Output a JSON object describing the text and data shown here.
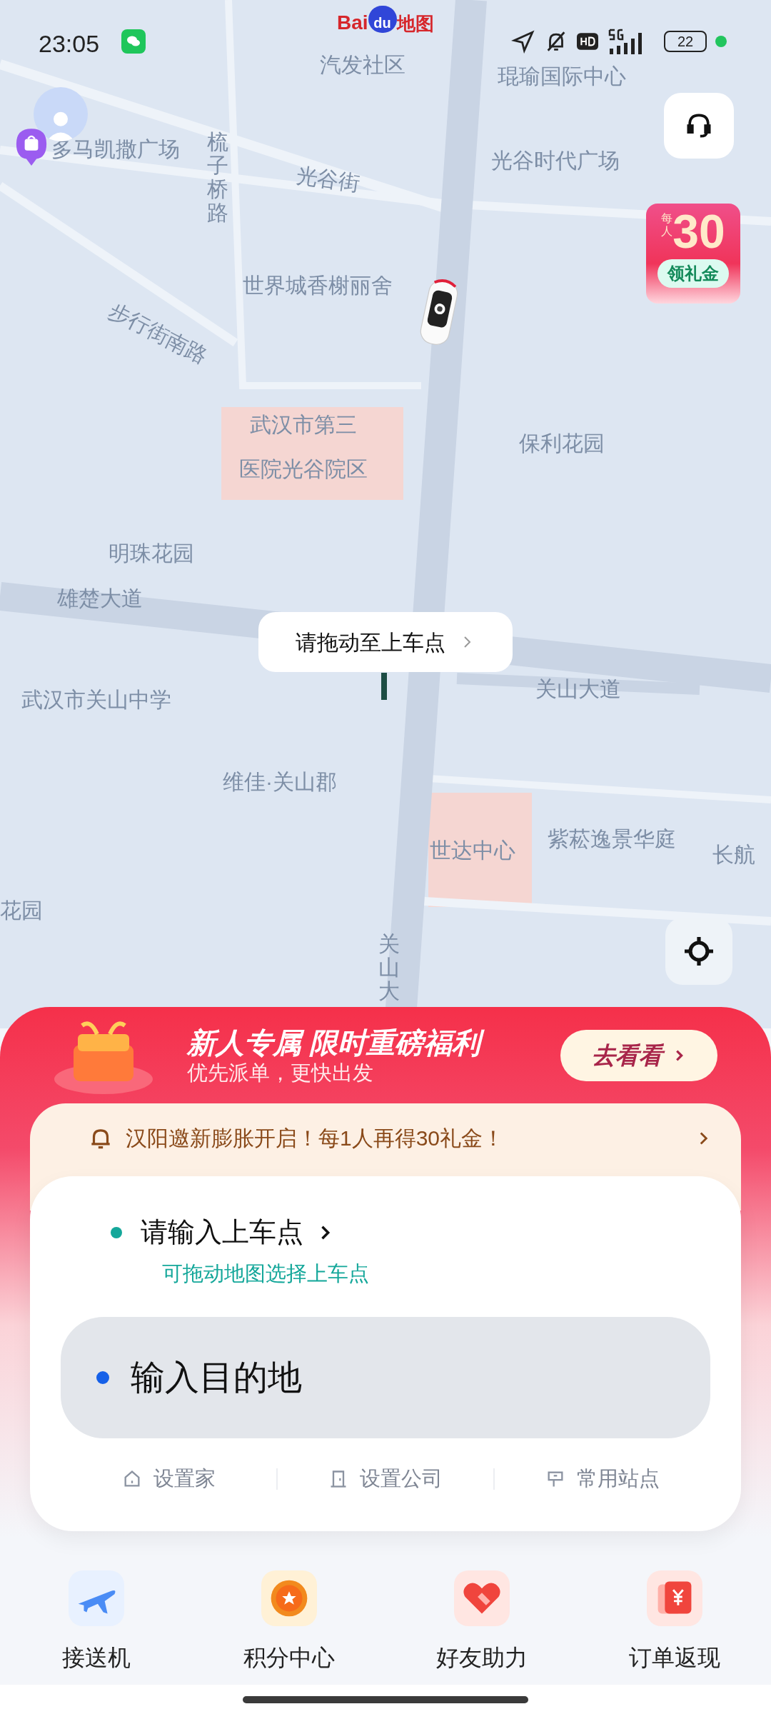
{
  "status_bar": {
    "time": "23:05",
    "battery": "22"
  },
  "map_logo": {
    "left": "Bai",
    "paw": "du",
    "right": "地图"
  },
  "map_labels": [
    {
      "text": "汽发社区",
      "kind": "flat"
    },
    {
      "text": "琨瑜国际中心",
      "kind": "flat"
    },
    {
      "text": "多马凯撒广场",
      "kind": "flat"
    },
    {
      "text": "梳子桥路",
      "kind": "vertical"
    },
    {
      "text": "光谷街",
      "kind": "tilted"
    },
    {
      "text": "光谷时代广场",
      "kind": "flat"
    },
    {
      "text": "世界城香榭丽舍",
      "kind": "flat"
    },
    {
      "text": "步行街南路",
      "kind": "tilted"
    },
    {
      "text": "武汉市第三",
      "kind": "flat"
    },
    {
      "text": "医院光谷院区",
      "kind": "flat"
    },
    {
      "text": "保利花园",
      "kind": "flat"
    },
    {
      "text": "明珠花园",
      "kind": "flat"
    },
    {
      "text": "雄楚大道",
      "kind": "flat"
    },
    {
      "text": "武汉市关山中学",
      "kind": "flat"
    },
    {
      "text": "关山大道",
      "kind": "flat"
    },
    {
      "text": "维佳·关山郡",
      "kind": "flat"
    },
    {
      "text": "世达中心",
      "kind": "flat"
    },
    {
      "text": "紫菘逸景华庭",
      "kind": "flat"
    },
    {
      "text": "长航",
      "kind": "flat"
    },
    {
      "text": "花园",
      "kind": "flat"
    },
    {
      "text": "关山大",
      "kind": "vertical"
    }
  ],
  "gift_badge": {
    "top": "每人",
    "amount": "30",
    "label": "领礼金"
  },
  "pickup_tip": {
    "text": "请拖动至上车点"
  },
  "promo_banner": {
    "title": "新人专属 限时重磅福利",
    "subtitle": "优先派单，更快出发",
    "button": "去看看"
  },
  "notice": {
    "text": "汉阳邀新膨胀开启！每1人再得30礼金！"
  },
  "pickup": {
    "label": "请输入上车点",
    "hint": "可拖动地图选择上车点"
  },
  "destination": {
    "placeholder": "输入目的地"
  },
  "quick_links": [
    "设置家",
    "设置公司",
    "常用站点"
  ],
  "bottom_nav": [
    "接送机",
    "积分中心",
    "好友助力",
    "订单返现"
  ]
}
